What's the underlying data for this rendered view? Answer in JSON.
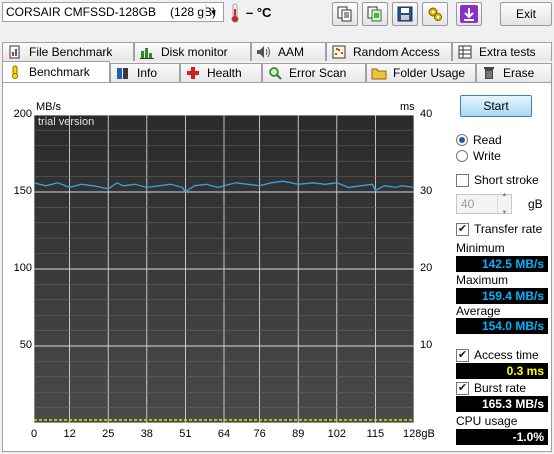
{
  "toolbar": {
    "drive": "CORSAIR CMFSSD-128GB",
    "capacity": "(128 gB)",
    "temperature": "– °C",
    "exit_label": "Exit",
    "icons": [
      "copy-info-icon",
      "copy-screenshot-icon",
      "save-icon",
      "options-icon",
      "download-icon"
    ]
  },
  "tabs_top": [
    {
      "label": "File Benchmark",
      "icon": "file-benchmark-icon"
    },
    {
      "label": "Disk monitor",
      "icon": "disk-monitor-icon"
    },
    {
      "label": "AAM",
      "icon": "speaker-icon"
    },
    {
      "label": "Random Access",
      "icon": "random-access-icon"
    },
    {
      "label": "Extra tests",
      "icon": "extra-tests-icon"
    }
  ],
  "tabs_bottom": [
    {
      "label": "Benchmark",
      "icon": "benchmark-icon"
    },
    {
      "label": "Info",
      "icon": "info-icon"
    },
    {
      "label": "Health",
      "icon": "health-cross-icon"
    },
    {
      "label": "Error Scan",
      "icon": "magnifier-icon"
    },
    {
      "label": "Folder Usage",
      "icon": "folder-icon"
    },
    {
      "label": "Erase",
      "icon": "trash-icon"
    }
  ],
  "chart_data": {
    "type": "line",
    "watermark": "trial version",
    "ylabel": "MB/s",
    "y2label": "ms",
    "xunit": "gB",
    "ylim": [
      0,
      200
    ],
    "y2lim": [
      0,
      40
    ],
    "xlim": [
      0,
      128
    ],
    "yticks": [
      200,
      150,
      100,
      50
    ],
    "y2ticks": [
      40,
      30,
      20,
      10
    ],
    "xticks": [
      "0",
      "12",
      "25",
      "38",
      "51",
      "64",
      "76",
      "89",
      "102",
      "115",
      "128gB"
    ],
    "series": [
      {
        "color": "#3aa0e0",
        "x": [
          0,
          4,
          8,
          12,
          16,
          20,
          25,
          28,
          30,
          34,
          38,
          42,
          46,
          50,
          51,
          54,
          58,
          62,
          64,
          68,
          72,
          76,
          80,
          84,
          89,
          94,
          98,
          102,
          106,
          110,
          114,
          115,
          118,
          122,
          124,
          128
        ],
        "values": [
          156,
          154,
          156,
          153,
          155,
          154,
          152,
          156,
          154,
          155,
          153,
          154,
          155,
          153,
          150,
          154,
          155,
          153,
          154,
          156,
          155,
          154,
          156,
          157,
          155,
          156,
          155,
          156,
          153,
          154,
          155,
          151,
          154,
          153,
          154,
          153
        ]
      },
      {
        "color": "#d8d800",
        "x": [
          0,
          16,
          32,
          48,
          64,
          80,
          96,
          112,
          128
        ],
        "values": [
          2,
          2,
          2,
          2,
          2,
          2,
          2,
          2,
          2
        ]
      }
    ]
  },
  "controls": {
    "start_label": "Start",
    "read_label": "Read",
    "write_label": "Write",
    "read_selected": true,
    "short_stroke_label": "Short stroke",
    "short_stroke_checked": false,
    "stroke_value": "40",
    "stroke_unit": "gB",
    "transfer_rate_label": "Transfer rate",
    "transfer_rate_checked": true,
    "minimum_label": "Minimum",
    "minimum_value": "142.5 MB/s",
    "maximum_label": "Maximum",
    "maximum_value": "159.4 MB/s",
    "average_label": "Average",
    "average_value": "154.0 MB/s",
    "access_time_label": "Access time",
    "access_time_checked": true,
    "access_time_value": "0.3 ms",
    "burst_rate_label": "Burst rate",
    "burst_rate_checked": true,
    "burst_rate_value": "165.3 MB/s",
    "cpu_usage_label": "CPU usage",
    "cpu_usage_value": "-1.0%"
  }
}
